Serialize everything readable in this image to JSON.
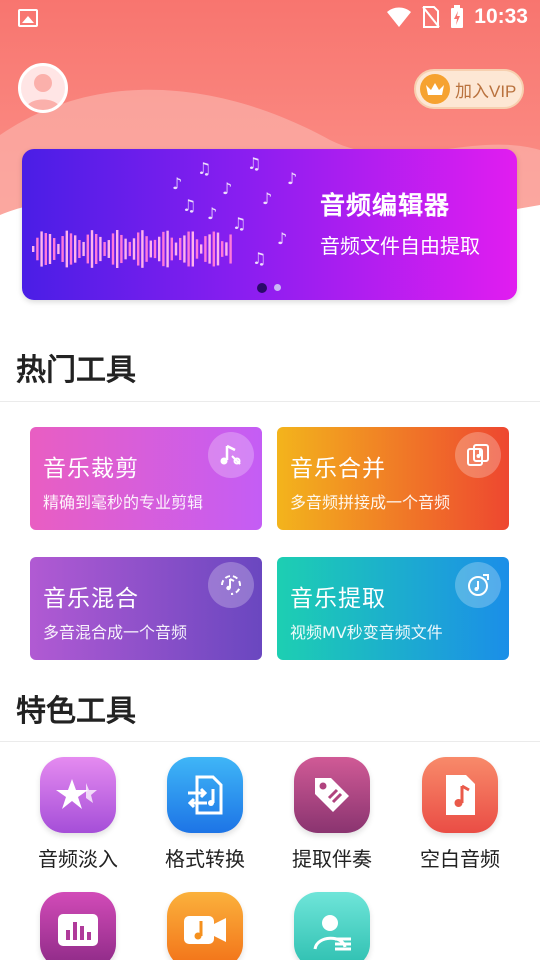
{
  "status_bar": {
    "time": "10:33"
  },
  "header": {
    "vip_label": "加入VIP"
  },
  "banner": {
    "title": "音频编辑器",
    "subtitle": "音频文件自由提取",
    "pages": 2,
    "active_page": 1
  },
  "hot_tools": {
    "title": "热门工具",
    "items": [
      {
        "title": "音乐裁剪",
        "desc": "精确到毫秒的专业剪辑",
        "icon": "music-note-scissors-icon"
      },
      {
        "title": "音乐合并",
        "desc": "多音频拼接成一个音频",
        "icon": "merge-icon"
      },
      {
        "title": "音乐混合",
        "desc": "多音混合成一个音频",
        "icon": "mix-circle-icon"
      },
      {
        "title": "音乐提取",
        "desc": "视频MV秒变音频文件",
        "icon": "extract-icon"
      }
    ]
  },
  "featured_tools": {
    "title": "特色工具",
    "items": [
      {
        "label": "音频淡入",
        "icon": "stars-icon",
        "color": "#c45ee0"
      },
      {
        "label": "格式转换",
        "icon": "convert-icon",
        "color": "#2c8ff2"
      },
      {
        "label": "提取伴奏",
        "icon": "tag-icon",
        "color": "#b0437e"
      },
      {
        "label": "空白音频",
        "icon": "music-file-icon",
        "color": "#f06a52"
      },
      {
        "label": "",
        "icon": "chart-icon",
        "color": "#b03a9a"
      },
      {
        "label": "",
        "icon": "video-music-icon",
        "color": "#f5901e"
      },
      {
        "label": "",
        "icon": "user-list-icon",
        "color": "#3fcfc0"
      }
    ]
  }
}
